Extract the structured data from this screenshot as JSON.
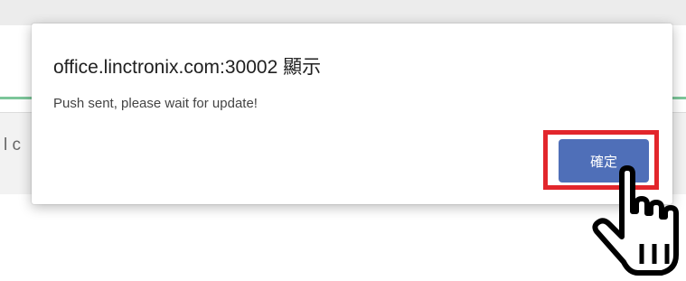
{
  "background": {
    "partial_text": "l c"
  },
  "dialog": {
    "title": "office.linctronix.com:30002 顯示",
    "message": "Push sent, please wait for update!",
    "ok_label": "確定"
  },
  "colors": {
    "button_blue": "#4f6fb8",
    "highlight_red": "#e2262c",
    "green_accent": "#7cc69a"
  },
  "icons": {
    "cursor": "hand-pointer-icon"
  }
}
